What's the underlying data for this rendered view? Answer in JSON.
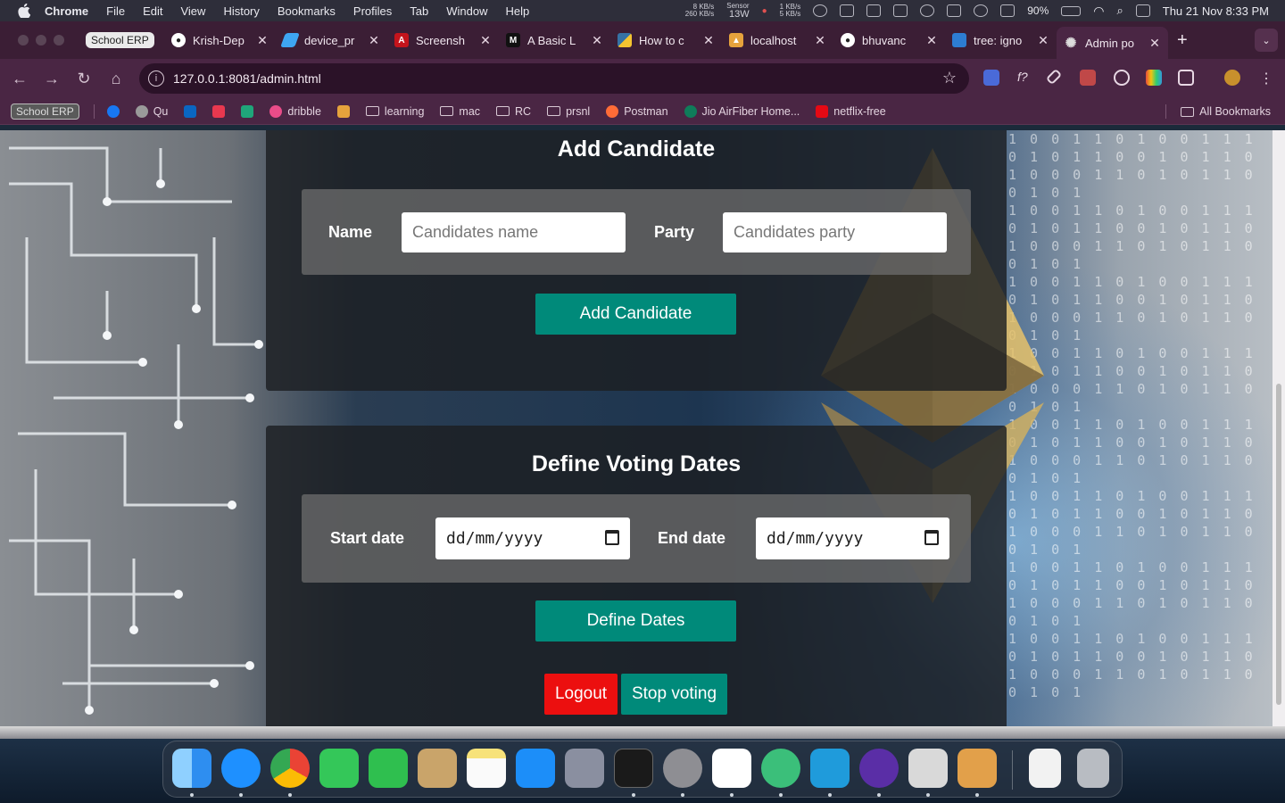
{
  "menubar": {
    "app_name": "Chrome",
    "items": [
      "File",
      "Edit",
      "View",
      "History",
      "Bookmarks",
      "Profiles",
      "Tab",
      "Window",
      "Help"
    ],
    "net_up": "8 KB/s",
    "net_down": "260 KB/s",
    "sensor_label": "Sensor",
    "sensor_value": "13W",
    "net2_up": "1 KB/s",
    "net2_down": "5 KB/s",
    "battery": "90%",
    "datetime": "Thu 21 Nov  8:33 PM"
  },
  "tabs": [
    {
      "title": "School ERP",
      "pinned": true,
      "favicon": "school-erp-icon",
      "color": "#eaeaea"
    },
    {
      "title": "Krish-Dep",
      "favicon": "github-icon",
      "color": "#ffffff"
    },
    {
      "title": "device_pr",
      "favicon": "flutter-icon",
      "color": "#3ea6f2"
    },
    {
      "title": "Screensh",
      "favicon": "adobe-icon",
      "color": "#c4141c"
    },
    {
      "title": "A Basic L",
      "favicon": "medium-icon",
      "color": "#111111"
    },
    {
      "title": "How to c",
      "favicon": "python-icon",
      "color": "#f4c430"
    },
    {
      "title": "localhost",
      "favicon": "ganache-icon",
      "color": "#e6a23c"
    },
    {
      "title": "bhuvanc",
      "favicon": "github-icon",
      "color": "#ffffff"
    },
    {
      "title": "tree: igno",
      "favicon": "git-tree-icon",
      "color": "#2d7dd2"
    },
    {
      "title": "Admin po",
      "favicon": "gear-icon",
      "color": "#dddddd",
      "active": true
    }
  ],
  "toolbar": {
    "url": "127.0.0.1:8081/admin.html"
  },
  "bookmarks": {
    "items": [
      {
        "label": "School ERP",
        "kind": "badge"
      },
      {
        "label": "",
        "kind": "icon",
        "color": "#1877f2",
        "icon": "facebook-icon"
      },
      {
        "label": "Qu",
        "kind": "icon",
        "color": "#9a9a9a",
        "icon": "quora-icon"
      },
      {
        "label": "",
        "kind": "icon",
        "color": "#0a66c2",
        "icon": "linkedin-icon"
      },
      {
        "label": "",
        "kind": "icon",
        "color": "#e8384f",
        "icon": "wellfound-icon"
      },
      {
        "label": "",
        "kind": "icon",
        "color": "#1fa67a",
        "icon": "script-icon"
      },
      {
        "label": "dribble",
        "kind": "icon",
        "color": "#ea4c89",
        "icon": "dribbble-icon"
      },
      {
        "label": "",
        "kind": "icon",
        "color": "#e6a23c",
        "icon": "ganache-icon"
      },
      {
        "label": "learning",
        "kind": "folder"
      },
      {
        "label": "mac",
        "kind": "folder"
      },
      {
        "label": "RC",
        "kind": "folder"
      },
      {
        "label": "prsnl",
        "kind": "folder"
      },
      {
        "label": "Postman",
        "kind": "icon",
        "color": "#ff6c37",
        "icon": "postman-icon"
      },
      {
        "label": "Jio AirFiber Home...",
        "kind": "icon",
        "color": "#0f7c5a",
        "icon": "jio-icon"
      },
      {
        "label": "netflix-free",
        "kind": "icon",
        "color": "#e50914",
        "icon": "netflix-icon"
      }
    ],
    "all_bookmarks": "All Bookmarks"
  },
  "page": {
    "add_candidate": {
      "title": "Add Candidate",
      "name_label": "Name",
      "name_placeholder": "Candidates name",
      "party_label": "Party",
      "party_placeholder": "Candidates party",
      "submit_label": "Add Candidate"
    },
    "voting_dates": {
      "title": "Define Voting Dates",
      "start_label": "Start date",
      "start_value": "dd/mm/yyyy",
      "end_label": "End date",
      "end_value": "dd/mm/yyyy",
      "submit_label": "Define Dates"
    },
    "logout_label": "Logout",
    "stop_voting_label": "Stop voting"
  },
  "binary_text": "1 0 0 1 1 0 1 0 0 1 1 1 0 1 0 1 1 0 0 1 0 1 1 0 1 0 0 0 1 1 0 1 0 1 1 0 0 1 0 1",
  "dock": [
    {
      "name": "finder-icon",
      "color": "#2e8ef0"
    },
    {
      "name": "safari-icon",
      "color": "#1e90ff"
    },
    {
      "name": "chrome-icon",
      "color": "#34a853"
    },
    {
      "name": "messages-icon",
      "color": "#34c759"
    },
    {
      "name": "facetime-icon",
      "color": "#2fbf4f"
    },
    {
      "name": "contacts-icon",
      "color": "#c9a46a"
    },
    {
      "name": "notes-icon",
      "color": "#f7e27a"
    },
    {
      "name": "app-store-icon",
      "color": "#1c8ef9"
    },
    {
      "name": "launchpad-icon",
      "color": "#8a8fa0"
    },
    {
      "name": "terminal-icon",
      "color": "#1a1a1a"
    },
    {
      "name": "system-settings-icon",
      "color": "#8e8e93"
    },
    {
      "name": "vscode-icon",
      "color": "#1f7ad6"
    },
    {
      "name": "broom-cleaner-icon",
      "color": "#3bbf7a"
    },
    {
      "name": "transfer-arrow-icon",
      "color": "#1f9bdb"
    },
    {
      "name": "orb-app-icon",
      "color": "#5a2ea6"
    },
    {
      "name": "preview-icon",
      "color": "#d9d9d9"
    },
    {
      "name": "sandbox-box-icon",
      "color": "#e2a04a"
    },
    {
      "name": "document-icon",
      "color": "#f2f2f2"
    },
    {
      "name": "trash-icon",
      "color": "#b8bcc2"
    }
  ]
}
